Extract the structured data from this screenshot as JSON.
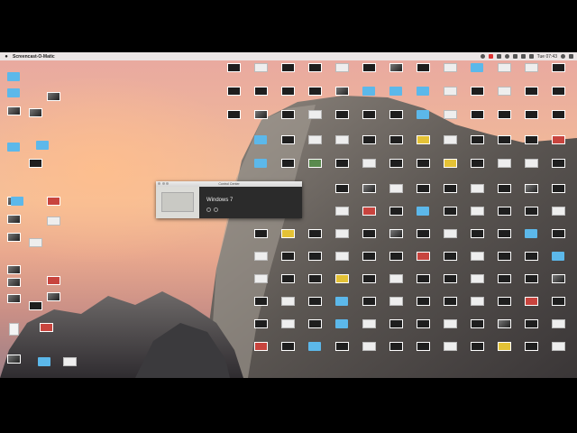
{
  "menubar": {
    "app_name": "Screencast-O-Matic",
    "clock": "Tue 07:43"
  },
  "control_center": {
    "title": "Control Center",
    "vm_name": "Windows 7"
  },
  "desktop_icons": [
    {
      "label": "",
      "kind": "folder"
    },
    {
      "label": "",
      "kind": "folder"
    },
    {
      "label": "",
      "kind": "shot"
    },
    {
      "label": "",
      "kind": "folder"
    },
    {
      "label": "",
      "kind": "shot"
    },
    {
      "label": "",
      "kind": "shot"
    },
    {
      "label": "",
      "kind": "shot"
    },
    {
      "label": "",
      "kind": "shot"
    },
    {
      "label": "",
      "kind": "shot"
    },
    {
      "label": "",
      "kind": "shot"
    },
    {
      "label": "",
      "kind": "doc"
    },
    {
      "label": "",
      "kind": "shot"
    },
    {
      "label": "",
      "kind": "shot"
    },
    {
      "label": "",
      "kind": "shot"
    },
    {
      "label": "",
      "kind": "dark"
    },
    {
      "label": "",
      "kind": "white"
    },
    {
      "label": "",
      "kind": "red"
    },
    {
      "label": "",
      "kind": "white"
    },
    {
      "label": "",
      "kind": "dark"
    },
    {
      "label": "",
      "kind": "red"
    },
    {
      "label": "",
      "kind": "shot"
    },
    {
      "label": "",
      "kind": "red"
    },
    {
      "label": "",
      "kind": "folder"
    },
    {
      "label": "",
      "kind": "white"
    },
    {
      "label": "",
      "kind": "folder"
    },
    {
      "label": "",
      "kind": "folder"
    },
    {
      "label": "",
      "kind": "dark"
    },
    {
      "label": "",
      "kind": "white"
    },
    {
      "label": "",
      "kind": "dark"
    },
    {
      "label": "",
      "kind": "dark"
    },
    {
      "label": "",
      "kind": "white"
    },
    {
      "label": "",
      "kind": "dark"
    },
    {
      "label": "",
      "kind": "shot"
    },
    {
      "label": "",
      "kind": "dark"
    },
    {
      "label": "",
      "kind": "white"
    },
    {
      "label": "",
      "kind": "folder"
    },
    {
      "label": "",
      "kind": "white"
    },
    {
      "label": "",
      "kind": "white"
    },
    {
      "label": "",
      "kind": "dark"
    },
    {
      "label": "",
      "kind": "dark"
    },
    {
      "label": "",
      "kind": "dark"
    },
    {
      "label": "",
      "kind": "dark"
    },
    {
      "label": "",
      "kind": "dark"
    },
    {
      "label": "",
      "kind": "shot"
    },
    {
      "label": "",
      "kind": "folder"
    },
    {
      "label": "",
      "kind": "folder"
    },
    {
      "label": "",
      "kind": "folder"
    },
    {
      "label": "",
      "kind": "white"
    },
    {
      "label": "",
      "kind": "dark"
    },
    {
      "label": "",
      "kind": "white"
    },
    {
      "label": "",
      "kind": "dark"
    },
    {
      "label": "",
      "kind": "dark"
    },
    {
      "label": "",
      "kind": "dark"
    },
    {
      "label": "",
      "kind": "shot"
    },
    {
      "label": "",
      "kind": "dark"
    },
    {
      "label": "",
      "kind": "white"
    },
    {
      "label": "",
      "kind": "dark"
    },
    {
      "label": "",
      "kind": "dark"
    },
    {
      "label": "",
      "kind": "dark"
    },
    {
      "label": "",
      "kind": "folder"
    },
    {
      "label": "",
      "kind": "white"
    },
    {
      "label": "",
      "kind": "dark"
    },
    {
      "label": "",
      "kind": "dark"
    },
    {
      "label": "",
      "kind": "dark"
    },
    {
      "label": "",
      "kind": "dark"
    },
    {
      "label": "",
      "kind": "folder"
    },
    {
      "label": "",
      "kind": "dark"
    },
    {
      "label": "",
      "kind": "white"
    },
    {
      "label": "",
      "kind": "white"
    },
    {
      "label": "",
      "kind": "dark"
    },
    {
      "label": "",
      "kind": "dark"
    },
    {
      "label": "",
      "kind": "yellow"
    },
    {
      "label": "",
      "kind": "white"
    },
    {
      "label": "",
      "kind": "dark"
    },
    {
      "label": "",
      "kind": "dark"
    },
    {
      "label": "",
      "kind": "dark"
    },
    {
      "label": "",
      "kind": "red"
    },
    {
      "label": "",
      "kind": "folder"
    },
    {
      "label": "",
      "kind": "dark"
    },
    {
      "label": "",
      "kind": "green"
    },
    {
      "label": "",
      "kind": "dark"
    },
    {
      "label": "",
      "kind": "white"
    },
    {
      "label": "",
      "kind": "dark"
    },
    {
      "label": "",
      "kind": "dark"
    },
    {
      "label": "",
      "kind": "yellow"
    },
    {
      "label": "",
      "kind": "dark"
    },
    {
      "label": "",
      "kind": "white"
    },
    {
      "label": "",
      "kind": "white"
    },
    {
      "label": "",
      "kind": "dark"
    },
    {
      "label": "",
      "kind": "dark"
    },
    {
      "label": "",
      "kind": "shot"
    },
    {
      "label": "",
      "kind": "white"
    },
    {
      "label": "",
      "kind": "dark"
    }
  ]
}
